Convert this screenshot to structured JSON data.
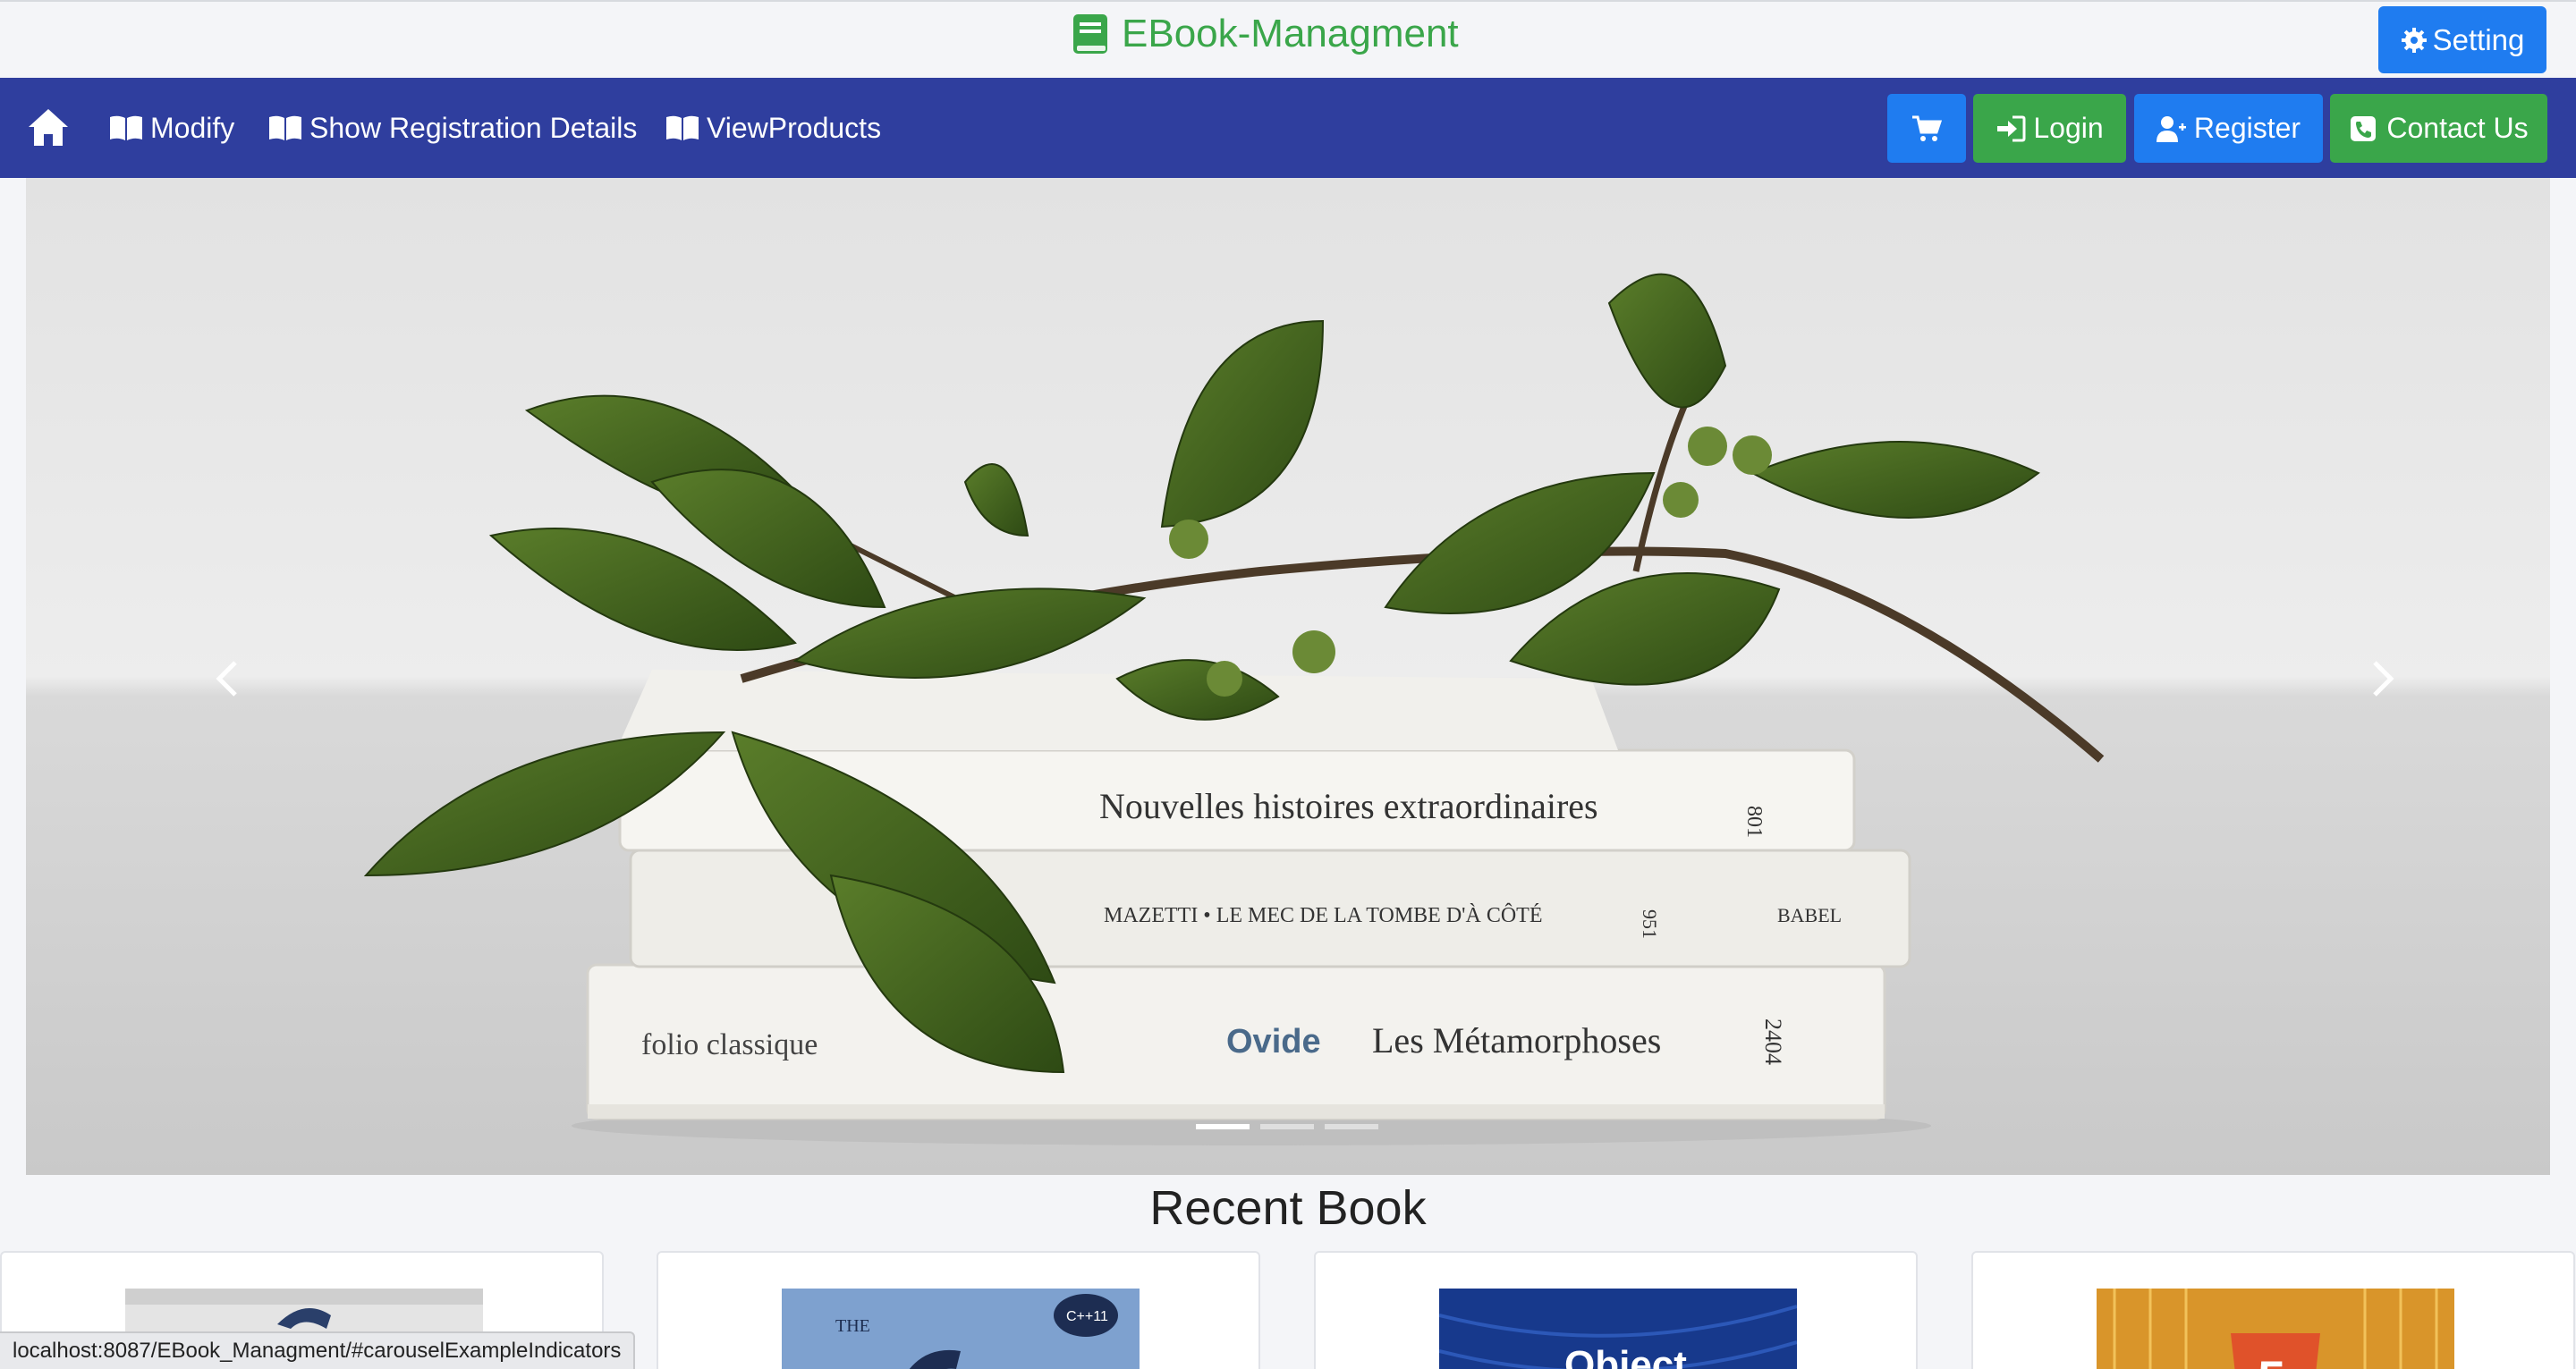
{
  "brand": {
    "title": "EBook-Managment",
    "color": "#3aa64a"
  },
  "setting_button": {
    "label": "Setting"
  },
  "navbar": {
    "bg_color": "#2f3e9e",
    "links": [
      {
        "label": "Modify",
        "icon": "open-book-icon"
      },
      {
        "label": "Show Registration Details",
        "icon": "open-book-icon"
      },
      {
        "label": "ViewProducts",
        "icon": "open-book-icon"
      }
    ],
    "buttons": {
      "cart": {
        "label": "",
        "icon": "cart-icon",
        "color": "#1f7cf0"
      },
      "login": {
        "label": "Login",
        "icon": "sign-in-icon",
        "color": "#3aa64a"
      },
      "register": {
        "label": "Register",
        "icon": "user-plus-icon",
        "color": "#1f7cf0"
      },
      "contact": {
        "label": "Contact Us",
        "icon": "phone-icon",
        "color": "#3aa64a"
      }
    }
  },
  "carousel": {
    "slide_count": 3,
    "active_slide": 1,
    "book_titles": [
      "Nouvelles histoires extraordinaires",
      "MAZETTI • LE MEC DE LA TOMBE D'À CÔTÉ",
      "Ovide",
      "Les Métamorphoses"
    ],
    "spine_labels": [
      "folio classique",
      "BABEL",
      "801",
      "951",
      "2404"
    ]
  },
  "recent": {
    "title": "Recent Book",
    "cards": [
      {
        "name": "book-card-1",
        "cover_text": ""
      },
      {
        "name": "book-card-2",
        "cover_text": "THE"
      },
      {
        "name": "book-card-3",
        "cover_text": "Object"
      },
      {
        "name": "book-card-4",
        "cover_text": ""
      }
    ]
  },
  "status_bar": {
    "url": "localhost:8087/EBook_Managment/#carouselExampleIndicators"
  }
}
